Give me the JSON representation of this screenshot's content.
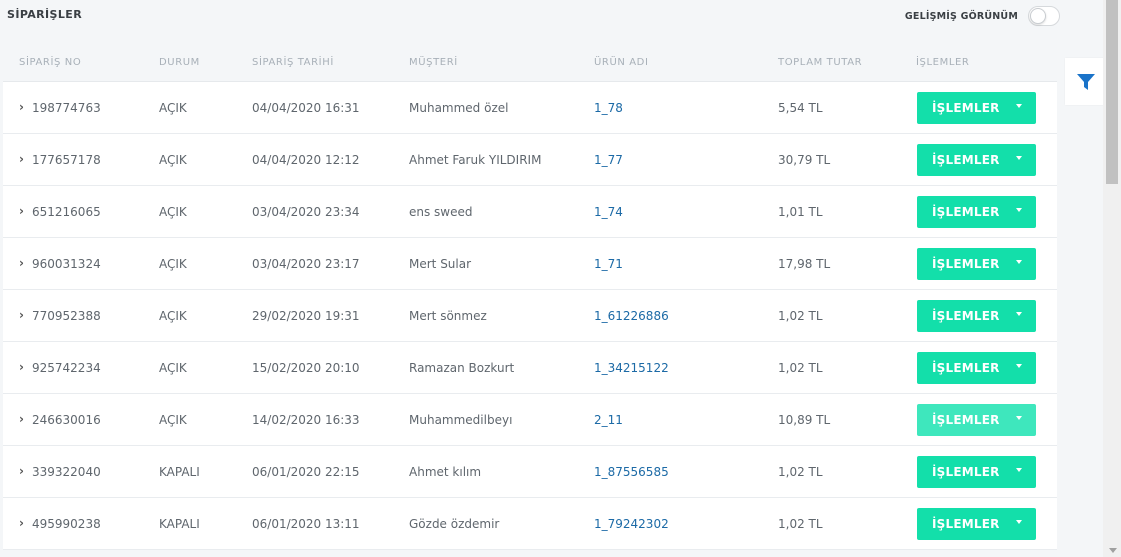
{
  "header": {
    "title": "SİPARİŞLER",
    "advanced_view_label": "GELİŞMİŞ GÖRÜNÜM",
    "advanced_view_enabled": false
  },
  "table": {
    "columns": [
      "SİPARİŞ NO",
      "DURUM",
      "SİPARİŞ TARİHİ",
      "MÜŞTERİ",
      "ÜRÜN ADI",
      "TOPLAM TUTAR",
      "İŞLEMLER"
    ],
    "rows": [
      {
        "order_no": "198774763",
        "status": "AÇIK",
        "date": "04/04/2020 16:31",
        "customer": "Muhammed özel",
        "product": "1_78",
        "total": "5,54 TL",
        "action": "İŞLEMLER"
      },
      {
        "order_no": "177657178",
        "status": "AÇIK",
        "date": "04/04/2020 12:12",
        "customer": "Ahmet Faruk YILDIRIM",
        "product": "1_77",
        "total": "30,79 TL",
        "action": "İŞLEMLER"
      },
      {
        "order_no": "651216065",
        "status": "AÇIK",
        "date": "03/04/2020 23:34",
        "customer": "ens sweed",
        "product": "1_74",
        "total": "1,01 TL",
        "action": "İŞLEMLER"
      },
      {
        "order_no": "960031324",
        "status": "AÇIK",
        "date": "03/04/2020 23:17",
        "customer": "Mert Sular",
        "product": "1_71",
        "total": "17,98 TL",
        "action": "İŞLEMLER"
      },
      {
        "order_no": "770952388",
        "status": "AÇIK",
        "date": "29/02/2020 19:31",
        "customer": "Mert sönmez",
        "product": "1_61226886",
        "total": "1,02 TL",
        "action": "İŞLEMLER"
      },
      {
        "order_no": "925742234",
        "status": "AÇIK",
        "date": "15/02/2020 20:10",
        "customer": "Ramazan Bozkurt",
        "product": "1_34215122",
        "total": "1,02 TL",
        "action": "İŞLEMLER"
      },
      {
        "order_no": "246630016",
        "status": "AÇIK",
        "date": "14/02/2020 16:33",
        "customer": "Muhammedilbeyı",
        "product": "2_11",
        "total": "10,89 TL",
        "action": "İŞLEMLER"
      },
      {
        "order_no": "339322040",
        "status": "KAPALI",
        "date": "06/01/2020 22:15",
        "customer": "Ahmet kılım",
        "product": "1_87556585",
        "total": "1,02 TL",
        "action": "İŞLEMLER"
      },
      {
        "order_no": "495990238",
        "status": "KAPALI",
        "date": "06/01/2020 13:11",
        "customer": "Gözde özdemir",
        "product": "1_79242302",
        "total": "1,02 TL",
        "action": "İŞLEMLER"
      }
    ]
  },
  "icons": {
    "row_expand": "chevron-right-icon",
    "filter": "filter-icon",
    "dropdown": "caret-down-icon"
  },
  "colors": {
    "action_button": "#13dfaa",
    "link": "#1c6aa6",
    "filter_icon": "#1a73c9"
  }
}
